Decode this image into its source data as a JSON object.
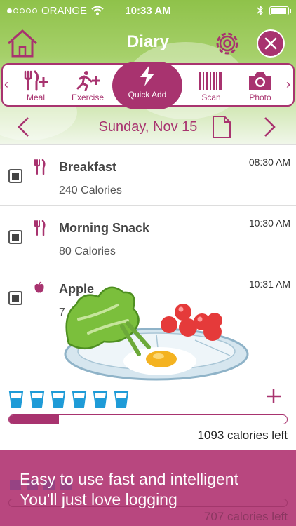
{
  "status": {
    "carrier": "ORANGE",
    "time": "10:33 AM"
  },
  "navbar": {
    "title": "Diary",
    "home_icon": "house-icon",
    "settings_icon": "gear-icon",
    "close_icon": "close-icon"
  },
  "toolbar": {
    "items": [
      {
        "label": "Meal",
        "icon": "fork-knife-plus-icon"
      },
      {
        "label": "Exercise",
        "icon": "runner-plus-icon"
      },
      {
        "label": "Quick Add",
        "icon": "lightning-icon"
      },
      {
        "label": "Scan",
        "icon": "barcode-icon"
      },
      {
        "label": "Photo",
        "icon": "camera-icon"
      }
    ]
  },
  "date": {
    "label": "Sunday, Nov 15"
  },
  "entries": [
    {
      "name": "Breakfast",
      "calories": "240 Calories",
      "time": "08:30 AM",
      "icon": "fork-knife-icon"
    },
    {
      "name": "Morning Snack",
      "calories": "80 Calories",
      "time": "10:30 AM",
      "icon": "fork-knife-icon"
    },
    {
      "name": "Apple",
      "calories": "7",
      "time": "10:31 AM",
      "icon": "apple-icon"
    }
  ],
  "water": {
    "cups": 6
  },
  "progress": {
    "fraction": 0.18
  },
  "calories_left": "1093 calories left",
  "banner": {
    "line1": "Easy to use fast and intelligent",
    "line2": "You'll just love logging",
    "ghost_calories_left": "707 calories left"
  },
  "colors": {
    "accent": "#a8336f",
    "header_green": "#8fc24a",
    "banner": "#b8477f"
  }
}
